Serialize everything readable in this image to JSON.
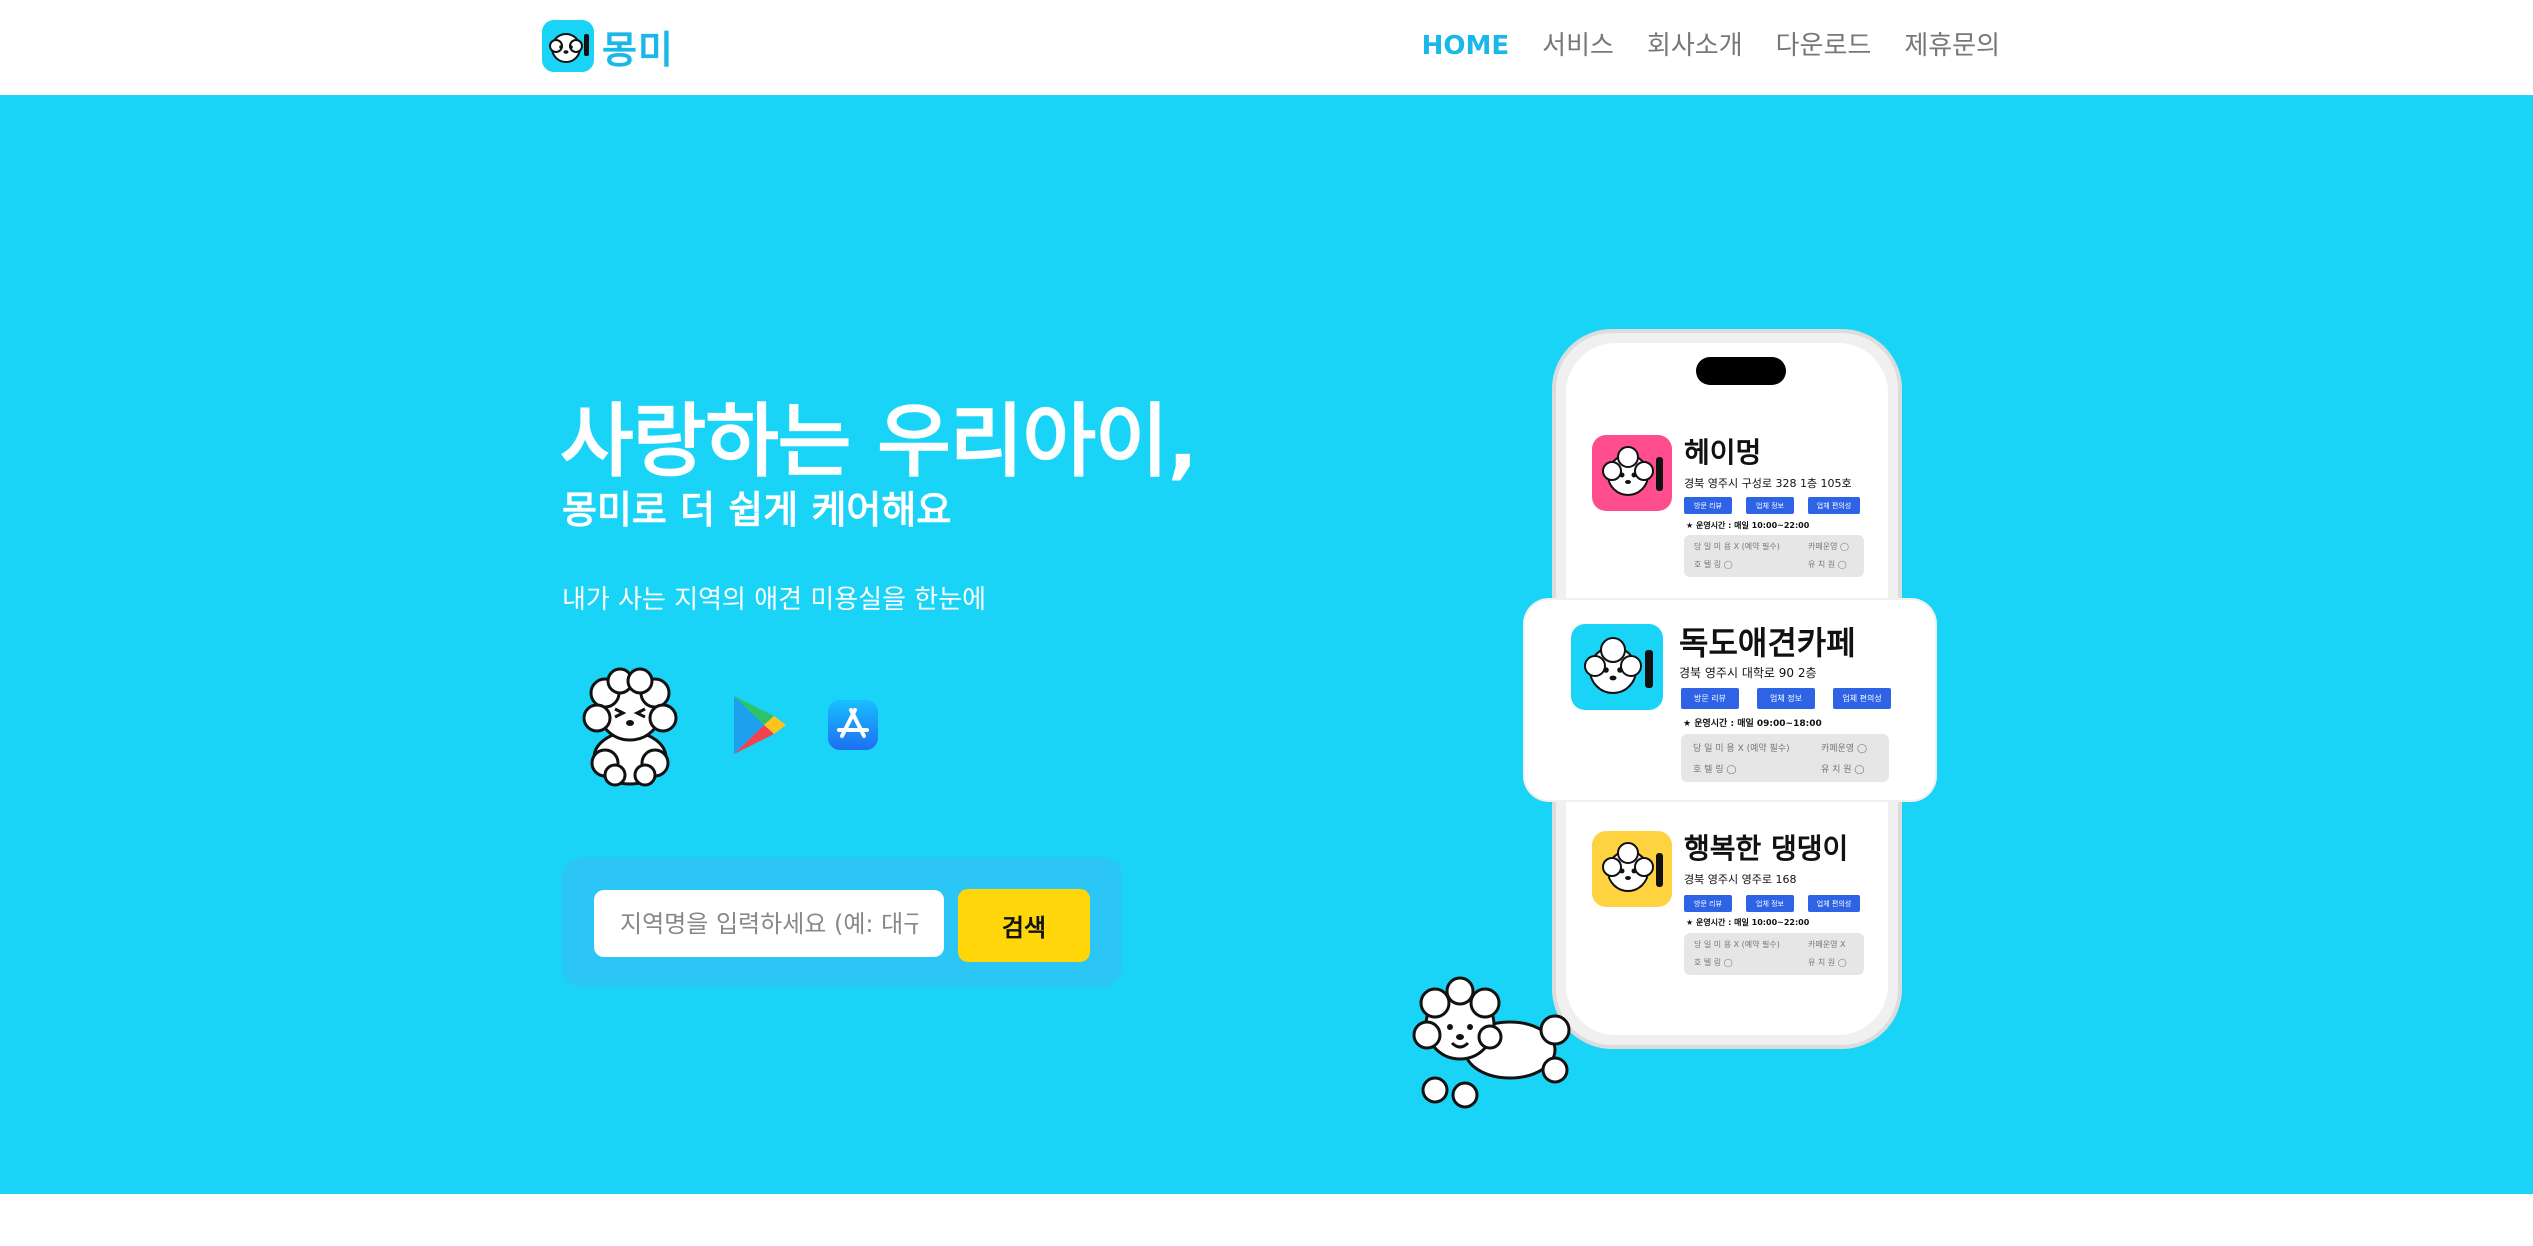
{
  "header": {
    "logo_text": "몽미",
    "nav": [
      {
        "label": "HOME"
      },
      {
        "label": "서비스"
      },
      {
        "label": "회사소개"
      },
      {
        "label": "다운로드"
      },
      {
        "label": "제휴문의"
      }
    ]
  },
  "hero": {
    "title": "사랑하는 우리아이,",
    "subtitle": "몽미로 더 쉽게 케어해요",
    "description": "내가 사는 지역의 애견 미용실을 한눈에",
    "search": {
      "placeholder": "지역명을 입력하세요 (예: 대구",
      "button_label": "검색"
    }
  },
  "phone": {
    "cards": [
      {
        "name": "헤이멍",
        "address": "경북 영주시 구성로 328 1층 105호",
        "badges": [
          "방문 리뷰",
          "업체 정보",
          "업체 편의성"
        ],
        "hours": "★ 운영시간 : 매일 10:00~22:00",
        "info": [
          "당 일 미 용 X (예약 필수)",
          "카페운영 ◯",
          "호 텔 링 ◯",
          "유 치 원 ◯"
        ],
        "icon_bg": "#ff4d8d"
      },
      {
        "name": "독도애견카페",
        "address": "경북 영주시 대학로 90 2층",
        "badges": [
          "방문 리뷰",
          "업체 정보",
          "업체 편의성"
        ],
        "hours": "★ 운영시간 : 매일 09:00~18:00",
        "info": [
          "당 일 미 용 X (예약 필수)",
          "카페운영 ◯",
          "호 텔 링 ◯",
          "유 치 원 ◯"
        ],
        "icon_bg": "#1ad4f7"
      },
      {
        "name": "행복한 댕댕이",
        "address": "경북 영주시 영주로 168",
        "badges": [
          "방문 리뷰",
          "업체 정보",
          "업체 편의성"
        ],
        "hours": "★ 운영시간 : 매일 10:00~22:00",
        "info": [
          "당 일 미 용 X (예약 필수)",
          "카페운영 X",
          "호 텔 링 ◯",
          "유 치 원 ◯"
        ],
        "icon_bg": "#ffd23f"
      }
    ]
  },
  "colors": {
    "hero_bg": "#1ad4f7",
    "accent": "#1ab8e8",
    "search_button": "#ffd60a",
    "badge": "#2e63e6"
  },
  "icons": [
    "dog-logo-icon",
    "sitting-dog-mascot",
    "google-play-icon",
    "app-store-icon",
    "jumping-dog-mascot",
    "comb-icon"
  ]
}
